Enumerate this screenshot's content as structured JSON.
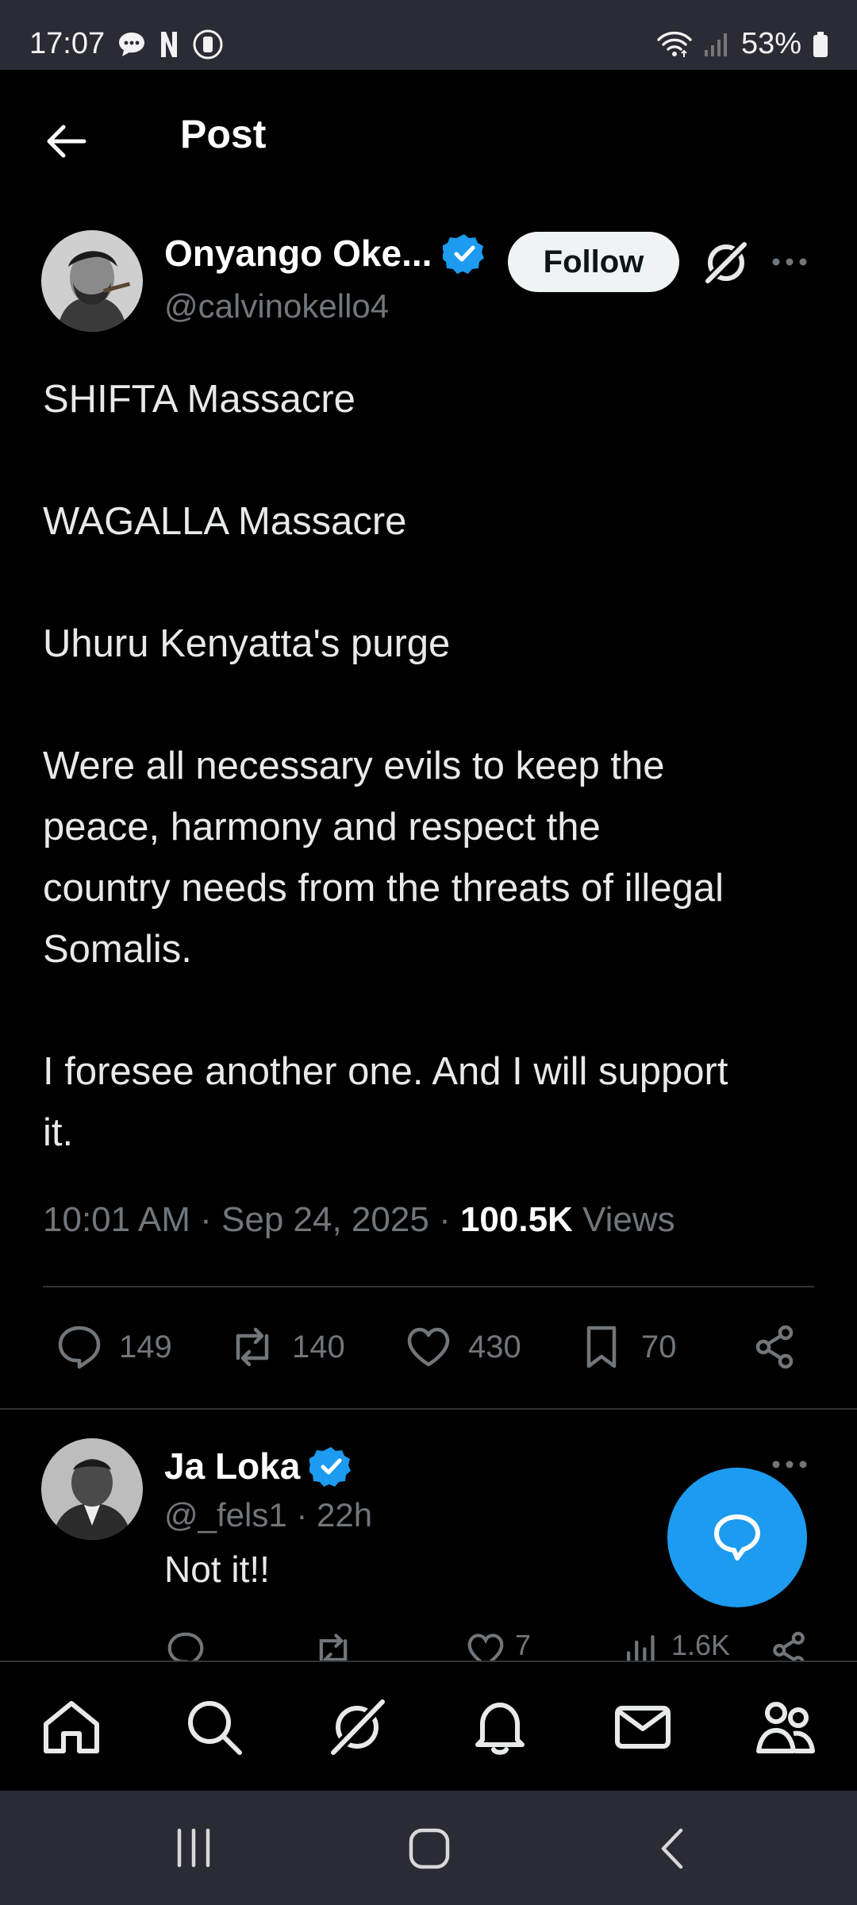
{
  "status_bar": {
    "time": "17:07",
    "battery": "53%"
  },
  "header": {
    "title": "Post"
  },
  "post": {
    "author_name": "Onyango Oke...",
    "author_handle": "@calvinokello4",
    "follow_label": "Follow",
    "text": "SHIFTA Massacre\n\nWAGALLA Massacre\n\nUhuru Kenyatta's purge\n\nWere all necessary evils to keep the\npeace, harmony and respect the\ncountry needs from the threats of illegal\nSomalis.\n\nI foresee another one. And I will support\nit.",
    "time": "10:01 AM",
    "date": "Sep 24, 2025",
    "views_count": "100.5K",
    "views_label": "Views",
    "stats": {
      "replies": "149",
      "reposts": "140",
      "likes": "430",
      "bookmarks": "70"
    }
  },
  "reply": {
    "author_name": "Ja Loka",
    "author_handle": "@_fels1",
    "age": "22h",
    "text": "Not it!!",
    "stats": {
      "likes": "7",
      "views": "1.6K"
    }
  },
  "colors": {
    "accent": "#1d9bf0",
    "background": "#000000",
    "muted": "#71767b",
    "verified": "#1d9bf0"
  },
  "icons": {
    "nav": [
      "home-icon",
      "search-icon",
      "grok-icon",
      "notifications-icon",
      "messages-icon",
      "communities-icon"
    ]
  }
}
